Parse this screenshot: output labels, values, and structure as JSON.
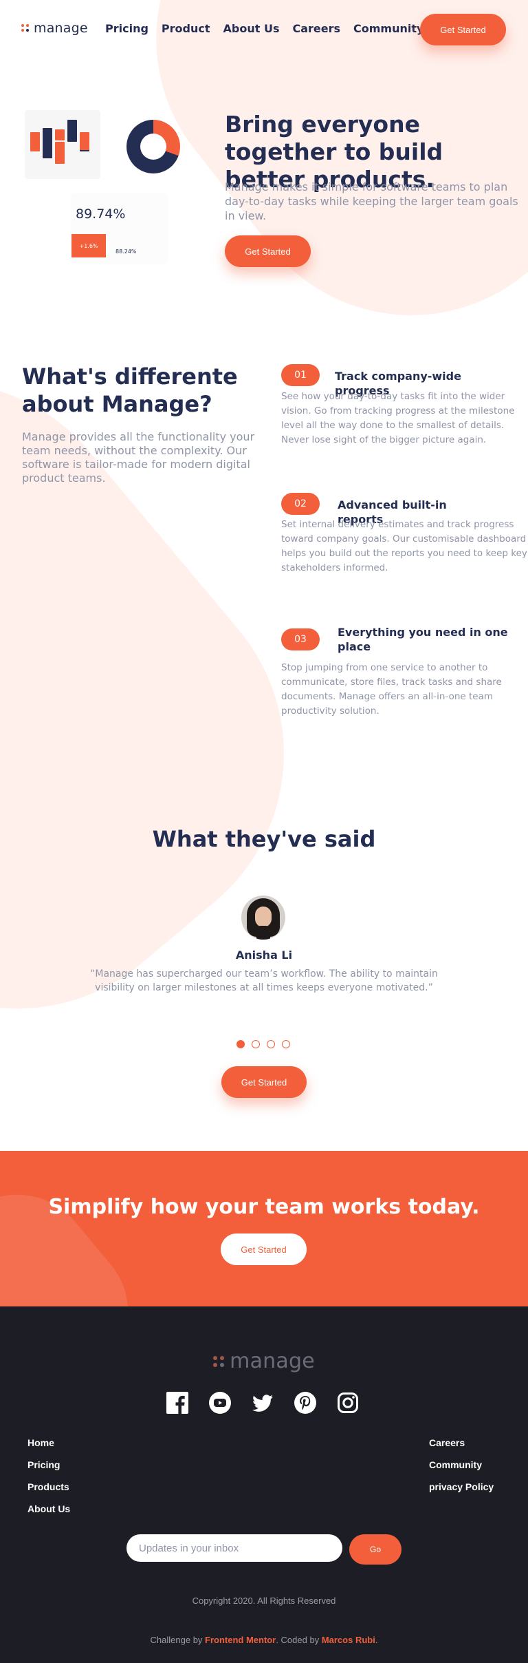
{
  "colors": {
    "accent": "#f25f3a",
    "dark_blue": "#242d52",
    "gray_text": "#9095a7",
    "blob": "#fff0ec",
    "footer_bg": "#1d1e25"
  },
  "header": {
    "logo_text": "manage",
    "nav": [
      "Pricing",
      "Product",
      "About Us",
      "Careers",
      "Community"
    ],
    "cta_label": "Get Started"
  },
  "hero": {
    "illustration": {
      "stat_value": "89.74%",
      "chip_value": "+1.6%",
      "small_value": "88.24%"
    },
    "title": "Bring everyone together to build better products.",
    "text": "Manage makes it simple for software teams to plan day-to-day tasks while keeping the larger team goals in view.",
    "cta_label": "Get Started"
  },
  "different": {
    "title": "What's differente about Manage?",
    "text": "Manage provides all the functionality your team needs, without the complexity. Our software is tailor-made for modern digital product teams.",
    "features": [
      {
        "num": "01",
        "title": "Track company-wide progress",
        "text": "See how your day-to-day tasks fit into the wider vision. Go from tracking progress at the milestone level all the way done to the smallest of details. Never lose sight of the bigger picture again."
      },
      {
        "num": "02",
        "title": "Advanced built-in reports",
        "text": "Set internal delivery estimates and track progress toward company goals. Our customisable dashboard helps you build out the reports you need to keep key stakeholders informed."
      },
      {
        "num": "03",
        "title": "Everything you need in one place",
        "text": "Stop jumping from one service to another to communicate, store files, track tasks and share documents. Manage offers an all-in-one team productivity solution."
      }
    ]
  },
  "testimonials": {
    "title": "What they've said",
    "name": "Anisha Li",
    "quote": "“Manage has supercharged our team’s workflow. The ability to maintain visibility on larger milestones at all times keeps everyone motivated.”",
    "slide_count": 4,
    "active_slide": 1,
    "cta_label": "Get Started"
  },
  "cta_band": {
    "title": "Simplify how your team works today.",
    "cta_label": "Get Started"
  },
  "footer": {
    "logo_text": "manage",
    "social_icons": [
      "facebook-icon",
      "youtube-icon",
      "twitter-icon",
      "pinterest-icon",
      "instagram-icon"
    ],
    "links_left": [
      "Home",
      "Pricing",
      "Products",
      "About Us"
    ],
    "links_right": [
      "Careers",
      "Community",
      "privacy Policy"
    ],
    "newsletter_placeholder": "Updates in your inbox",
    "go_label": "Go",
    "copyright": "Copyright 2020. All Rights Reserved",
    "challenge_prefix": "Challenge by ",
    "challenge_link": "Frontend Mentor",
    "coded_prefix": ". Coded by ",
    "coded_link": "Marcos Rubi",
    "suffix": "."
  }
}
